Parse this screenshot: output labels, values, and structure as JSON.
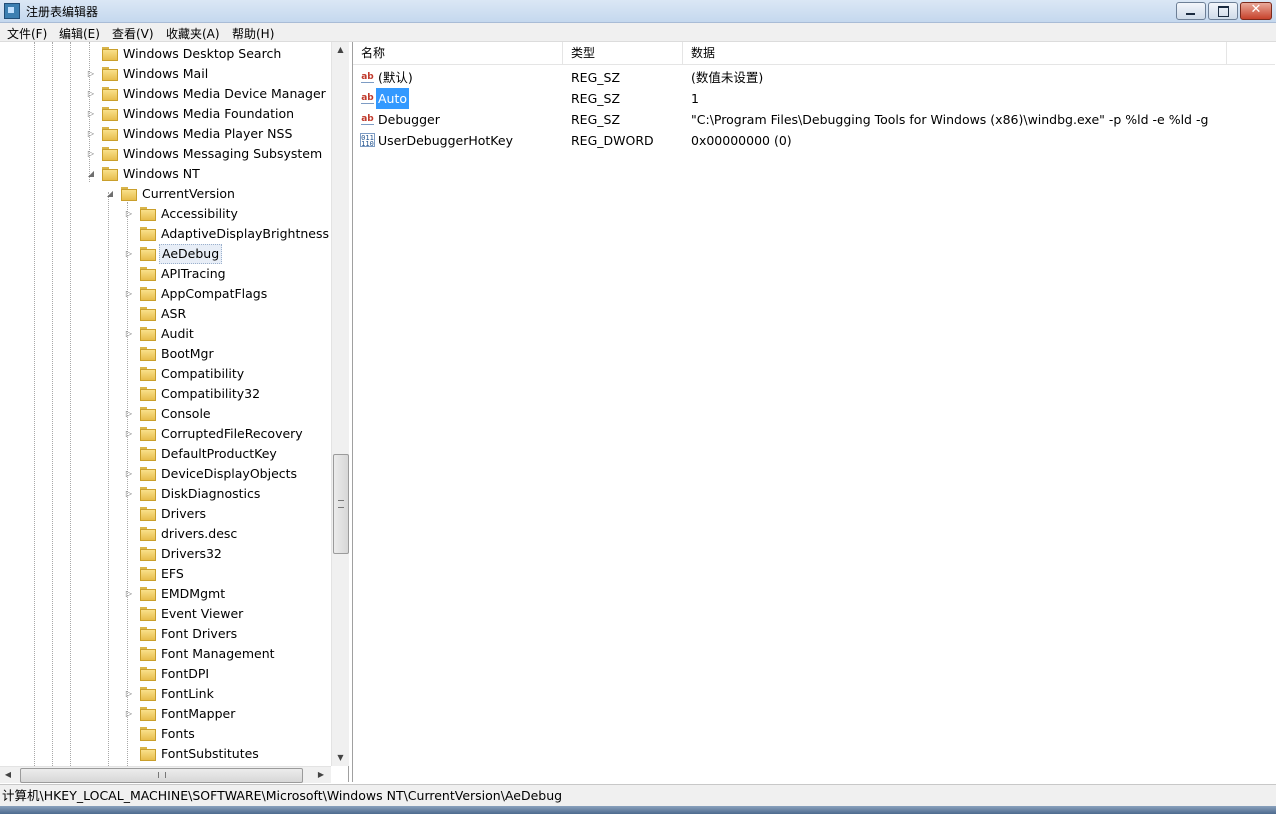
{
  "window": {
    "title": "注册表编辑器",
    "buttons": {
      "minimize": "minimize",
      "maximize": "maximize",
      "close": "✕"
    }
  },
  "menu": [
    {
      "label": "文件(F)"
    },
    {
      "label": "编辑(E)"
    },
    {
      "label": "查看(V)"
    },
    {
      "label": "收藏夹(A)"
    },
    {
      "label": "帮助(H)"
    }
  ],
  "tree": {
    "top_nodes": [
      {
        "label": "Windows Desktop Search",
        "expander": ""
      },
      {
        "label": "Windows Mail",
        "expander": "▷"
      },
      {
        "label": "Windows Media Device Manager",
        "expander": "▷"
      },
      {
        "label": "Windows Media Foundation",
        "expander": "▷"
      },
      {
        "label": "Windows Media Player NSS",
        "expander": "▷"
      },
      {
        "label": "Windows Messaging Subsystem",
        "expander": "▷"
      },
      {
        "label": "Windows NT",
        "expander": "◢"
      }
    ],
    "current_version": {
      "label": "CurrentVersion",
      "expander": "◢"
    },
    "children": [
      {
        "label": "Accessibility",
        "expander": "▷"
      },
      {
        "label": "AdaptiveDisplayBrightness",
        "expander": ""
      },
      {
        "label": "AeDebug",
        "expander": "▷",
        "selected": true
      },
      {
        "label": "APITracing",
        "expander": ""
      },
      {
        "label": "AppCompatFlags",
        "expander": "▷"
      },
      {
        "label": "ASR",
        "expander": ""
      },
      {
        "label": "Audit",
        "expander": "▷"
      },
      {
        "label": "BootMgr",
        "expander": ""
      },
      {
        "label": "Compatibility",
        "expander": ""
      },
      {
        "label": "Compatibility32",
        "expander": ""
      },
      {
        "label": "Console",
        "expander": "▷"
      },
      {
        "label": "CorruptedFileRecovery",
        "expander": "▷"
      },
      {
        "label": "DefaultProductKey",
        "expander": ""
      },
      {
        "label": "DeviceDisplayObjects",
        "expander": "▷"
      },
      {
        "label": "DiskDiagnostics",
        "expander": "▷"
      },
      {
        "label": "Drivers",
        "expander": ""
      },
      {
        "label": "drivers.desc",
        "expander": ""
      },
      {
        "label": "Drivers32",
        "expander": ""
      },
      {
        "label": "EFS",
        "expander": ""
      },
      {
        "label": "EMDMgmt",
        "expander": "▷"
      },
      {
        "label": "Event Viewer",
        "expander": ""
      },
      {
        "label": "Font Drivers",
        "expander": ""
      },
      {
        "label": "Font Management",
        "expander": ""
      },
      {
        "label": "FontDPI",
        "expander": ""
      },
      {
        "label": "FontLink",
        "expander": "▷"
      },
      {
        "label": "FontMapper",
        "expander": "▷"
      },
      {
        "label": "Fonts",
        "expander": ""
      },
      {
        "label": "FontSubstitutes",
        "expander": ""
      }
    ],
    "scroll": {
      "vertical_grip": "≡",
      "horizontal_grip": "⦀",
      "up": "▲",
      "down": "▼",
      "left": "◀",
      "right": "▶"
    }
  },
  "list": {
    "columns": {
      "name": "名称",
      "type": "类型",
      "data": "数据"
    },
    "rows": [
      {
        "icon": "string-value-icon",
        "name": "(默认)",
        "type": "REG_SZ",
        "data": "(数值未设置)"
      },
      {
        "icon": "string-value-icon",
        "name": "Auto",
        "type": "REG_SZ",
        "data": "1",
        "selected": true
      },
      {
        "icon": "string-value-icon",
        "name": "Debugger",
        "type": "REG_SZ",
        "data": "\"C:\\Program Files\\Debugging Tools for Windows (x86)\\windbg.exe\" -p %ld -e %ld -g"
      },
      {
        "icon": "binary-value-icon",
        "name": "UserDebuggerHotKey",
        "type": "REG_DWORD",
        "data": "0x00000000 (0)"
      }
    ]
  },
  "status": {
    "path": "计算机\\HKEY_LOCAL_MACHINE\\SOFTWARE\\Microsoft\\Windows NT\\CurrentVersion\\AeDebug"
  },
  "colors": {
    "selection": "#3399ff",
    "folder": "#f2cf63"
  }
}
